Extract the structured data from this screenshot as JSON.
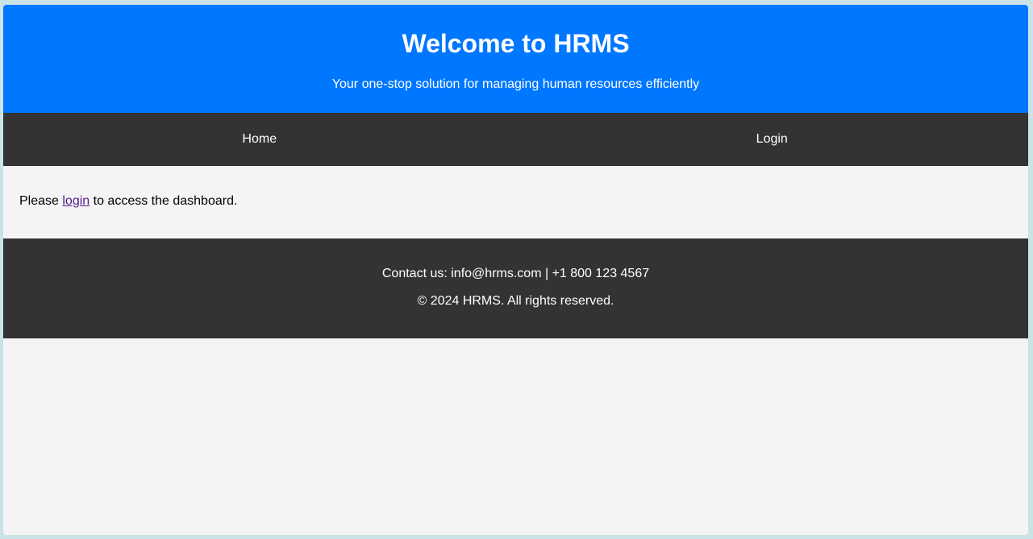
{
  "header": {
    "title": "Welcome to HRMS",
    "subtitle": "Your one-stop solution for managing human resources efficiently"
  },
  "nav": {
    "items": [
      {
        "label": "Home"
      },
      {
        "label": "Login"
      }
    ]
  },
  "main": {
    "text_before": "Please ",
    "link_label": "login",
    "text_after": " to access the dashboard."
  },
  "footer": {
    "contact": "Contact us: info@hrms.com | +1 800 123 4567",
    "copyright": "© 2024 HRMS. All rights reserved."
  },
  "colors": {
    "header_bg": "#0077ff",
    "nav_bg": "#333333",
    "footer_bg": "#333333",
    "page_bg": "#f4f4f4",
    "visited_link": "#551a8b"
  }
}
